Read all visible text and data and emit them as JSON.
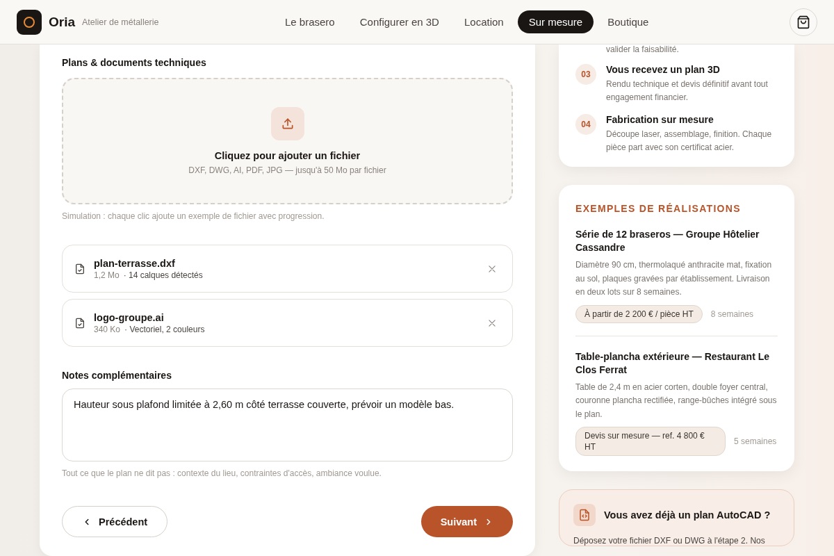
{
  "header": {
    "brand": "Oria",
    "tagline": "Atelier de métallerie",
    "nav": [
      {
        "label": "Le brasero",
        "selected": false
      },
      {
        "label": "Configurer en 3D",
        "selected": false
      },
      {
        "label": "Location",
        "selected": false
      },
      {
        "label": "Sur mesure",
        "selected": true
      },
      {
        "label": "Boutique",
        "selected": false
      }
    ]
  },
  "upload": {
    "title": "Plans & documents techniques",
    "dropzone_title": "Cliquez pour ajouter un fichier",
    "dropzone_hint": "DXF, DWG, AI, PDF, JPG — jusqu'à 50 Mo par fichier",
    "note": "Simulation : chaque clic ajoute un exemple de fichier avec progression.",
    "files": [
      {
        "name": "plan-terrasse.dxf",
        "size": "1,2 Mo",
        "detail": "· 14 calques détectés"
      },
      {
        "name": "logo-groupe.ai",
        "size": "340 Ko",
        "detail": "· Vectoriel, 2 couleurs"
      }
    ]
  },
  "notes": {
    "label": "Notes complémentaires",
    "value": "Hauteur sous plafond limitée à 2,60 m côté terrasse couverte, prévoir un modèle bas.",
    "hint": "Tout ce que le plan ne dit pas : contexte du lieu, contraintes d'accès, ambiance voulue."
  },
  "actions": {
    "previous": "Précédent",
    "next": "Suivant"
  },
  "steps": {
    "cut_text": "valider la faisabilité.",
    "items": [
      {
        "number": "03",
        "title": "Vous recevez un plan 3D",
        "text": "Rendu technique et devis définitif avant tout engagement financier."
      },
      {
        "number": "04",
        "title": "Fabrication sur mesure",
        "text": "Découpe laser, assemblage, finition. Chaque pièce part avec son certificat acier."
      }
    ]
  },
  "examples": {
    "title": "EXEMPLES DE RÉALISATIONS",
    "items": [
      {
        "title": "Série de 12 braseros — Groupe Hôtelier Cassandre",
        "text": "Diamètre 90 cm, thermolaqué anthracite mat, fixation au sol, plaques gravées par établissement. Livraison en deux lots sur 8 semaines.",
        "price": "À partir de 2 200 € / pièce HT",
        "duration": "8 semaines"
      },
      {
        "title": "Table-plancha extérieure — Restaurant Le Clos Ferrat",
        "text": "Table de 2,4 m en acier corten, double foyer central, couronne plancha rectifiée, range-bûches intégré sous le plan.",
        "price": "Devis sur mesure — ref. 4 800 € HT",
        "duration": "5 semaines"
      }
    ]
  },
  "autocad": {
    "title": "Vous avez déjà un plan AutoCAD ?",
    "text": "Déposez votre fichier DXF ou DWG à l'étape 2. Nos"
  }
}
